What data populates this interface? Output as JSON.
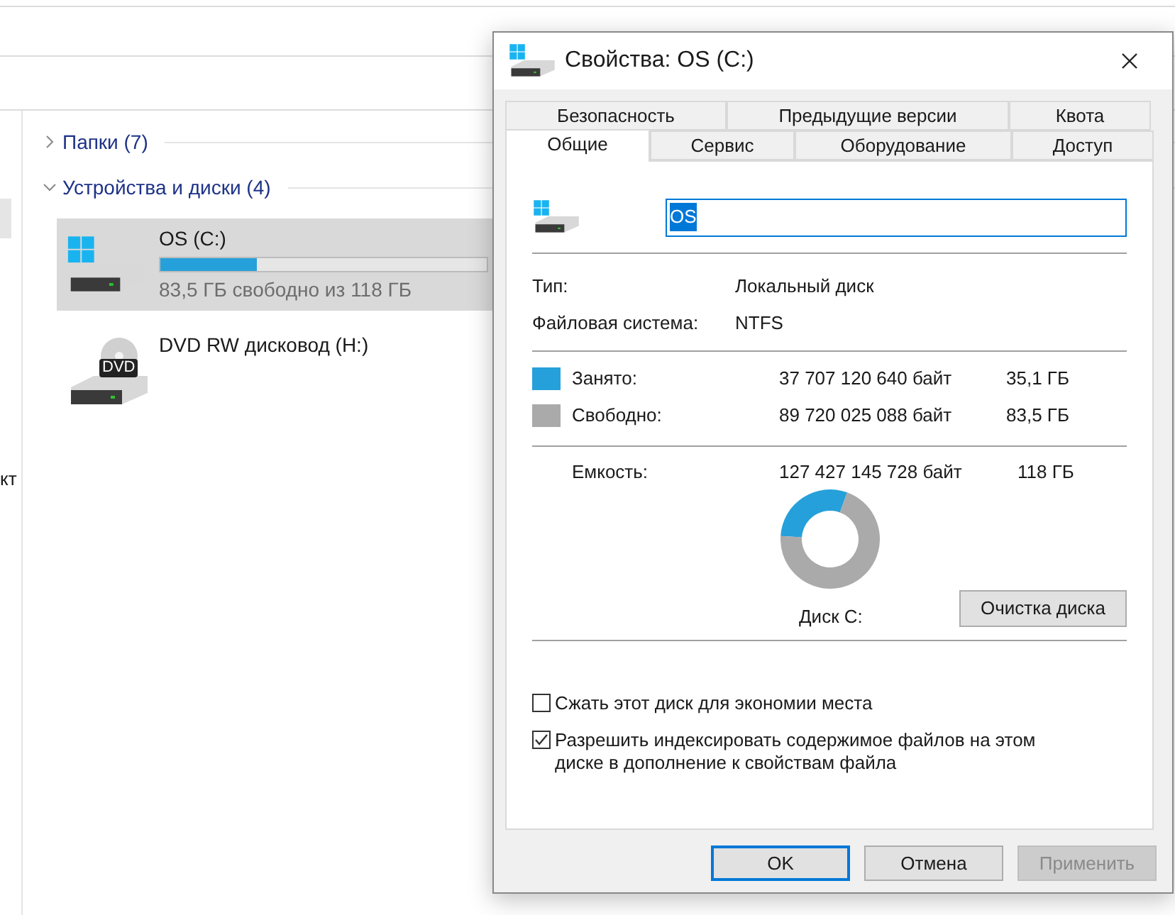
{
  "explorer": {
    "nav_items": [
      {
        "label": "кт",
        "selected": false
      }
    ],
    "sections": [
      {
        "title": "Папки (7)",
        "expanded": false
      },
      {
        "title": "Устройства и диски (4)",
        "expanded": true
      }
    ],
    "drives": [
      {
        "kind": "disk",
        "name": "OS (C:)",
        "level": 0.297,
        "free": "83,5 ГБ свободно из 118 ГБ",
        "selected": true
      },
      {
        "kind": "dvd",
        "name": "DVD RW дисковод (H:)",
        "badge": "DVD",
        "selected": false
      }
    ]
  },
  "dialog": {
    "title": "Свойства: OS (C:)",
    "tab_rows": [
      [
        {
          "label": "Безопасность",
          "selected": false
        },
        {
          "label": "Предыдущие версии",
          "selected": false
        },
        {
          "label": "Квота",
          "selected": false
        }
      ],
      [
        {
          "label": "Общие",
          "selected": true
        },
        {
          "label": "Сервис",
          "selected": false
        },
        {
          "label": "Оборудование",
          "selected": false
        },
        {
          "label": "Доступ",
          "selected": false
        }
      ]
    ],
    "name_field": {
      "value": "OS"
    },
    "info": [
      {
        "label": "Тип:",
        "value": "Локальный диск"
      },
      {
        "label": "Файловая система:",
        "value": "NTFS"
      }
    ],
    "usage": [
      {
        "label": "Занято:",
        "bytes": "37 707 120 640 байт",
        "size": "35,1 ГБ",
        "color": "#26a0da"
      },
      {
        "label": "Свободно:",
        "bytes": "89 720 025 088 байт",
        "size": "83,5 ГБ",
        "color": "#aaaaaa"
      }
    ],
    "capacity": {
      "label": "Емкость:",
      "bytes": "127 427 145 728 байт",
      "size": "118 ГБ"
    },
    "chart_data": {
      "type": "donut",
      "title": "Диск C:",
      "values": [
        29.6,
        70.4
      ]
    },
    "cleanup_button": "Очистка диска",
    "options": [
      {
        "label": "Сжать этот диск для экономии места",
        "checked": false
      },
      {
        "label": "Разрешить индексировать содержимое файлов на этом диске в дополнение к свойствам файла",
        "checked": true
      }
    ],
    "buttons": [
      {
        "label": "OK",
        "kind": "default"
      },
      {
        "label": "Отмена",
        "kind": "normal"
      },
      {
        "label": "Применить",
        "kind": "disabled"
      }
    ]
  }
}
